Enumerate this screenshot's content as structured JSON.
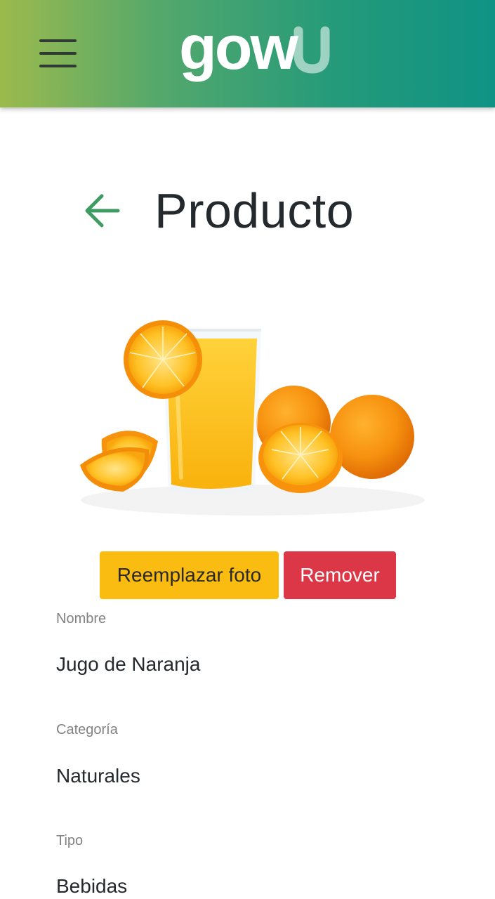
{
  "header": {
    "logo_text": "gow",
    "menu_icon": "hamburger-menu-icon",
    "gradient_colors": [
      "#9cba4c",
      "#0f9384"
    ]
  },
  "page": {
    "title": "Producto",
    "back_icon": "arrow-left-icon",
    "back_icon_color": "#3e9c63"
  },
  "product_image": {
    "description_icon": "orange-juice-image"
  },
  "actions": {
    "replace_label": "Reemplazar foto",
    "remove_label": "Remover",
    "replace_color": "#fbbc12",
    "remove_color": "#dc3747"
  },
  "fields": [
    {
      "label": "Nombre",
      "value": "Jugo de Naranja"
    },
    {
      "label": "Categoría",
      "value": "Naturales"
    },
    {
      "label": "Tipo",
      "value": "Bebidas"
    }
  ]
}
